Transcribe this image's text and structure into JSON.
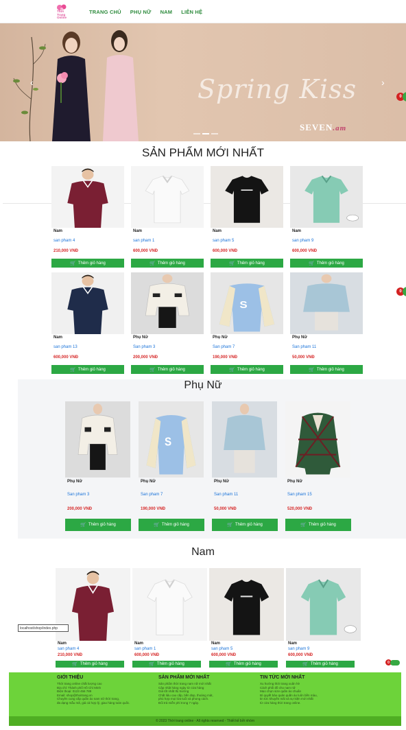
{
  "header": {
    "logo_text": "Thời Trang Online",
    "nav": [
      "TRANG CHỦ",
      "PHỤ NỮ",
      "NAM",
      "LIÊN HỆ"
    ]
  },
  "banner": {
    "script_text": "Spring Kiss",
    "brand": "SEVEN",
    "brand_suffix": ".am"
  },
  "colors": {
    "accent": "#2ca844",
    "nav": "#2e8b3d",
    "price": "#d62828",
    "link": "#1a73d9",
    "footer": "#6dd33a"
  },
  "cart_badge_count": "0",
  "add_to_cart_label": "Thêm giỏ hàng",
  "new_products": {
    "title": "SẢN PHẨM MỚI NHẤT",
    "items": [
      {
        "category": "Nam",
        "name": "san pham 4",
        "price": "210,000 VNĐ",
        "img": "maroon-polo"
      },
      {
        "category": "Nam",
        "name": "san pham 1",
        "price": "600,000 VNĐ",
        "img": "white-tee"
      },
      {
        "category": "Nam",
        "name": "san pham 5",
        "price": "600,000 VNĐ",
        "img": "black-tee"
      },
      {
        "category": "Nam",
        "name": "san pham 9",
        "price": "600,000 VNĐ",
        "img": "mint-polo"
      },
      {
        "category": "Nam",
        "name": "san pham 13",
        "price": "600,000 VNĐ",
        "img": "navy-polo"
      },
      {
        "category": "Phụ Nữ",
        "name": "San pham 3",
        "price": "200,000 VNĐ",
        "img": "tweed-jacket"
      },
      {
        "category": "Phụ Nữ",
        "name": "San pham 7",
        "price": "190,000 VNĐ",
        "img": "varsity-jacket"
      },
      {
        "category": "Phụ Nữ",
        "name": "San pham 11",
        "price": "50,000 VNĐ",
        "img": "blue-tweed"
      }
    ]
  },
  "women": {
    "title": "Phụ Nữ",
    "items": [
      {
        "category": "Phụ Nữ",
        "name": "San pham 3",
        "price": "200,000 VNĐ",
        "img": "tweed-jacket"
      },
      {
        "category": "Phụ Nữ",
        "name": "San pham 7",
        "price": "190,000 VNĐ",
        "img": "varsity-jacket"
      },
      {
        "category": "Phụ Nữ",
        "name": "San pham 11",
        "price": "50,000 VNĐ",
        "img": "blue-tweed"
      },
      {
        "category": "Phụ Nữ",
        "name": "San pham 15",
        "price": "520,000 VNĐ",
        "img": "plaid-jacket"
      }
    ]
  },
  "men": {
    "title": "Nam",
    "items": [
      {
        "category": "Nam",
        "name": "san pham 4",
        "price": "210,000 VNĐ",
        "img": "maroon-polo"
      },
      {
        "category": "Nam",
        "name": "san pham 1",
        "price": "600,000 VNĐ",
        "img": "white-tee"
      },
      {
        "category": "Nam",
        "name": "san pham 5",
        "price": "600,000 VNĐ",
        "img": "black-tee"
      },
      {
        "category": "Nam",
        "name": "san pham 9",
        "price": "600,000 VNĐ",
        "img": "mint-polo"
      }
    ]
  },
  "footer": {
    "columns": [
      {
        "title": "GIỚI THIỆU",
        "lines": [
          "Thời trang online chất lượng cao",
          "Địa chỉ: Thành phố Hồ Chí Minh",
          "Điện thoại: 0123 456 789",
          "Email: shop@thoitrang.vn",
          "Chuyên cung cấp quần áo nam nữ thời trang,",
          "đa dạng mẫu mã, giá cả hợp lý, giao hàng toàn quốc."
        ]
      },
      {
        "title": "SẢN PHẨM MỚI NHẤT",
        "lines": [
          "Sản phẩm thời trang nam nữ mới nhất",
          "Cập nhật hàng ngày từ cửa hàng",
          "Giá tốt nhất thị trường",
          "Chất liệu cao cấp, bền đẹp, thoáng mát,",
          "phù hợp mọi lứa tuổi và phong cách.",
          "Đổi trả miễn phí trong 7 ngày."
        ]
      },
      {
        "title": "TIN TỨC MỚI NHẤT",
        "lines": [
          "Xu hướng thời trang xuân hè",
          "Cách phối đồ cho nam nữ",
          "Mẹo chọn size quần áo chuẩn",
          "Bí quyết bảo quản quần áo luôn bền màu,",
          "tin tức khuyến mãi và sự kiện mới nhất",
          "từ cửa hàng thời trang online."
        ]
      }
    ],
    "copyright": "© 2023 Thời trang online - All rights reserved - Thiết kế bởi nhóm"
  },
  "tooltip_text": "localhost/shop/index.php"
}
